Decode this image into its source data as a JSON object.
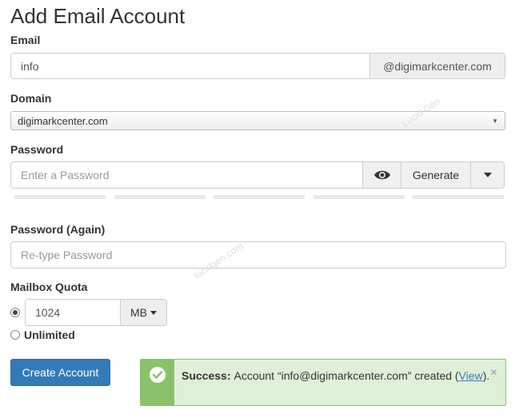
{
  "page_title": "Add Email Account",
  "email": {
    "label": "Email",
    "value": "info",
    "domain_suffix": "@digimarkcenter.com"
  },
  "domain": {
    "label": "Domain",
    "selected": "digimarkcenter.com"
  },
  "password": {
    "label": "Password",
    "placeholder": "Enter a Password",
    "show_icon": "eye-icon",
    "generate_label": "Generate",
    "dropdown_icon": "caret-down-icon",
    "strength_bars": 5
  },
  "password_again": {
    "label": "Password (Again)",
    "placeholder": "Re-type Password"
  },
  "quota": {
    "label": "Mailbox Quota",
    "value": "1024",
    "unit": "MB",
    "unlimited_label": "Unlimited",
    "selected_option": "custom"
  },
  "create_button": "Create Account",
  "alert": {
    "title": "Success:",
    "message_before": "Account “info@digimarkcenter.com” created (",
    "link_text": "View",
    "message_after": ").",
    "close_symbol": "×",
    "icon": "check-circle-icon"
  },
  "watermark": [
    "Lucid Gen",
    "lucidgen.com"
  ],
  "colors": {
    "primary": "#337ab7",
    "success_border": "#8cc16b",
    "success_bg": "#dff0d8"
  }
}
